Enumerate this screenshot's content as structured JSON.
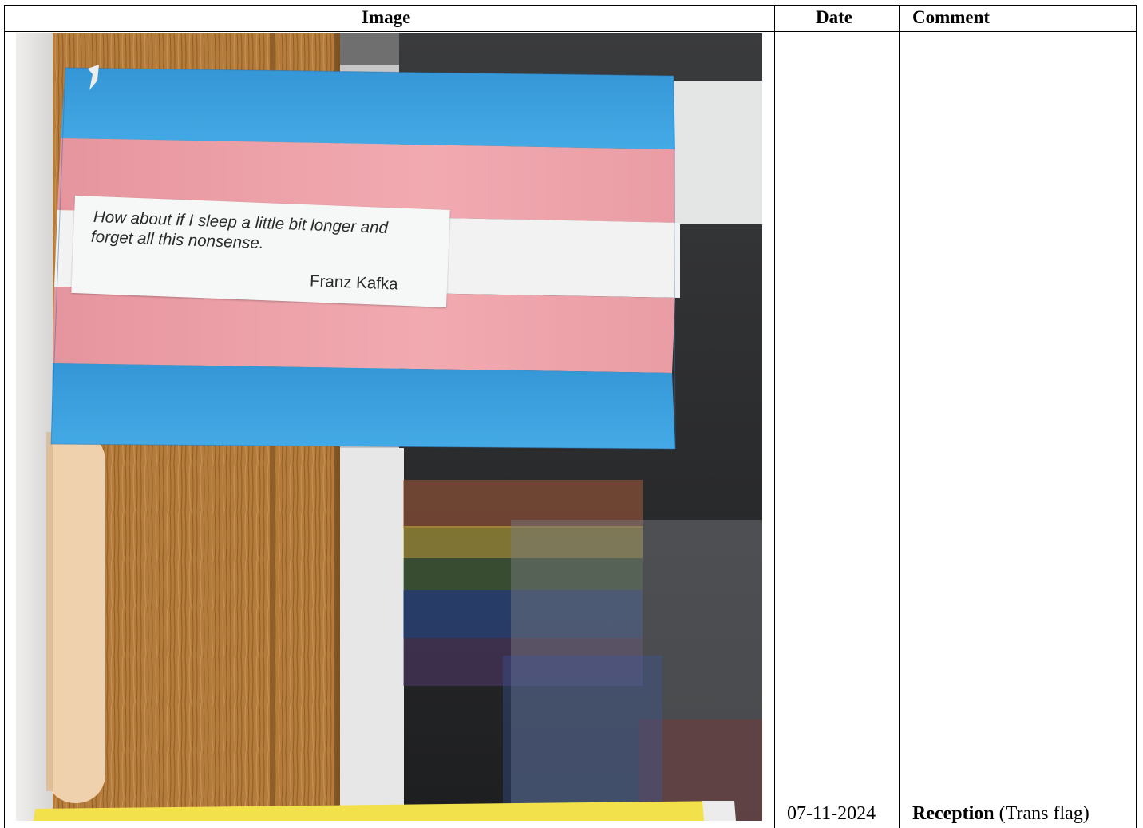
{
  "table": {
    "headers": {
      "image": "Image",
      "date": "Date",
      "comment": "Comment"
    },
    "rows": [
      {
        "date": "07-11-2024",
        "comment_bold": "Reception",
        "comment_rest": " (Trans flag)",
        "photo": {
          "quote_line1": "How about if I sleep a little bit longer and",
          "quote_line2": "forget all this nonsense.",
          "quote_author": "Franz Kafka"
        }
      }
    ]
  },
  "colors": {
    "flag_blue": "#3aa3e3",
    "flag_pink": "#eaa0a8",
    "flag_white": "#f4f4f4",
    "wood": "#b07a3a"
  }
}
